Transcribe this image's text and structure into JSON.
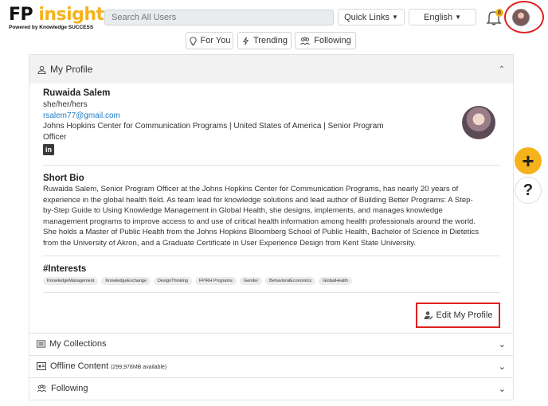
{
  "header": {
    "logo_main_a": "FP ",
    "logo_main_b": "insight",
    "logo_sub": "Powered by Knowledge SUCCESS",
    "search_placeholder": "Search All Users",
    "quick_links_label": "Quick Links",
    "language_label": "English",
    "notification_count": "0"
  },
  "nav": {
    "for_you": "For You",
    "trending": "Trending",
    "following": "Following"
  },
  "profile_section": {
    "title": "My Profile",
    "name": "Ruwaida Salem",
    "pronouns": "she/her/hers",
    "email": "rsalem77@gmail.com",
    "affiliation_line1": "Johns Hopkins Center for Communication Programs | United States of America | Senior Program",
    "affiliation_line2": "Officer",
    "linkedin_icon_text": "in",
    "bio_title": "Short Bio",
    "bio_lines": [
      "Ruwaida Salem, Senior Program Officer at the Johns Hopkins Center for Communication Programs, has nearly 20 years of",
      "experience in the global health field. As team lead for knowledge solutions and lead author of Building Better Programs: A Step-",
      "by-Step Guide to Using Knowledge Management in Global Health, she designs, implements, and manages knowledge",
      "management programs to improve access to and use of critical health information among health professionals around the world.",
      "She holds a Master of Public Health from the Johns Hopkins Bloomberg School of Public Health, Bachelor of Science in Dietetics",
      "from the University of Akron, and a Graduate Certificate in User Experience Design from Kent State University."
    ],
    "interests_title": "#Interests",
    "interests": [
      "KnowledgeManagement",
      "KnowledgeExchange",
      "DesignThinking",
      "FP/RH Programs",
      "Gender",
      "BehavioralEconomics",
      "GlobalHealth"
    ],
    "edit_label": "Edit My Profile"
  },
  "sections": {
    "collections": "My Collections",
    "offline": "Offline Content",
    "offline_note": "(299,978MB available)",
    "following": "Following"
  },
  "floating": {
    "plus": "+",
    "help": "?"
  },
  "colors": {
    "accent": "#f5b21b",
    "highlight": "#e02020",
    "link": "#1f7bc4"
  }
}
